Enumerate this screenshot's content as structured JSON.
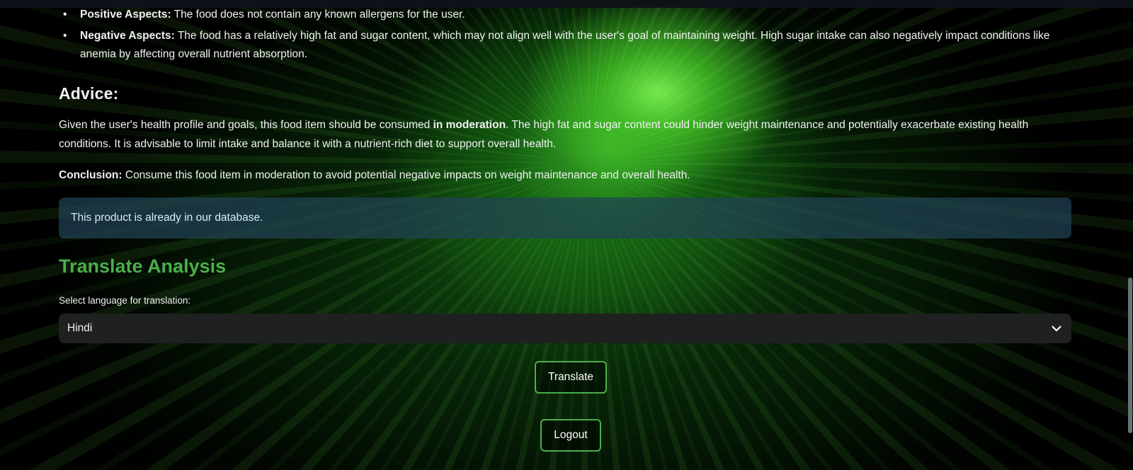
{
  "analysis": {
    "aspects": [
      {
        "label": "Positive Aspects:",
        "text": " The food does not contain any known allergens for the user."
      },
      {
        "label": "Negative Aspects:",
        "text": " The food has a relatively high fat and sugar content, which may not align well with the user's goal of maintaining weight. High sugar intake can also negatively impact conditions like anemia by affecting overall nutrient absorption."
      }
    ],
    "advice_heading": "Advice:",
    "advice_before": "Given the user's health profile and goals, this food item should be consumed ",
    "advice_bold": "in moderation",
    "advice_after": ". The high fat and sugar content could hinder weight maintenance and potentially exacerbate existing health conditions. It is advisable to limit intake and balance it with a nutrient-rich diet to support overall health.",
    "conclusion_label": "Conclusion:",
    "conclusion_text": " Consume this food item in moderation to avoid potential negative impacts on weight maintenance and overall health."
  },
  "info_message": "This product is already in our database.",
  "translate": {
    "title": "Translate Analysis",
    "select_label": "Select language for translation:",
    "selected_language": "Hindi",
    "translate_button": "Translate"
  },
  "logout_button": "Logout",
  "colors": {
    "accent_green": "#4cae4c",
    "info_bg": "#214254",
    "select_bg": "#1f2020",
    "topbar": "#0e1117"
  },
  "icons": {
    "select_chevron": "chevron-down-icon",
    "list_bullet": "bullet-icon"
  }
}
